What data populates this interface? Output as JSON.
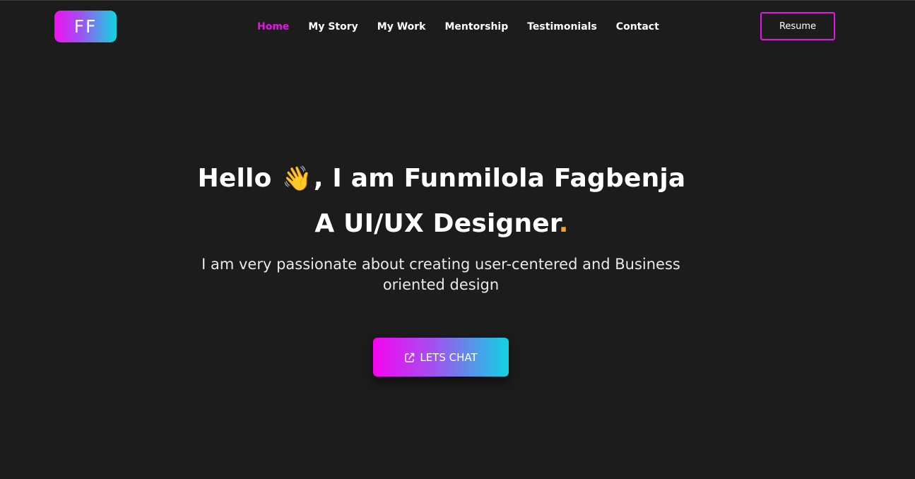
{
  "logo": {
    "text": "FF"
  },
  "nav": {
    "items": [
      {
        "label": "Home",
        "active": true
      },
      {
        "label": "My Story"
      },
      {
        "label": "My Work"
      },
      {
        "label": "Mentorship"
      },
      {
        "label": "Testimonials"
      },
      {
        "label": "Contact"
      }
    ]
  },
  "header": {
    "resume_label": "Resume"
  },
  "hero": {
    "greeting": "Hello",
    "wave_emoji": "👋",
    "intro": ", I am Funmilola Fagbenja",
    "role": "A UI/UX Designer",
    "role_dot": ".",
    "tagline": "I am very passionate about creating user-centered and Business oriented design",
    "cta_label": "LETS CHAT",
    "cta_icon": "share-icon"
  },
  "colors": {
    "background": "#1c1c1c",
    "accent_pink": "#e314e6",
    "accent_cyan": "#10d6e0",
    "dot_orange": "#f5a623"
  }
}
